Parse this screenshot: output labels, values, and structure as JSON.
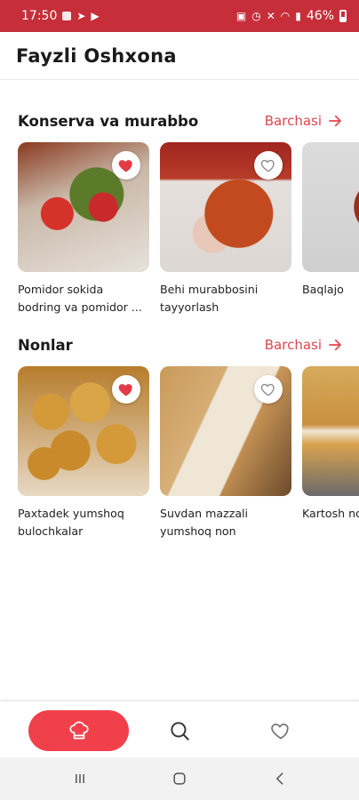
{
  "status_bar": {
    "time": "17:50",
    "battery": "46%"
  },
  "app_bar": {
    "title": "Fayzli Oshxona"
  },
  "sections": [
    {
      "title": "Konserva va murabbo",
      "see_all_label": "Barchasi",
      "items": [
        {
          "title": "Pomidor sokida bodring va pomidor ...",
          "favorite": true
        },
        {
          "title": "Behi murabbosini tayyorlash",
          "favorite": false
        },
        {
          "title": "Baqlajo",
          "favorite": false
        }
      ]
    },
    {
      "title": "Nonlar",
      "see_all_label": "Barchasi",
      "items": [
        {
          "title": "Paxtadek yumshoq bulochkalar",
          "favorite": true
        },
        {
          "title": "Suvdan mazzali yumshoq non",
          "favorite": false
        },
        {
          "title": "Kartosh non",
          "favorite": false
        }
      ]
    }
  ],
  "bottom_nav": {
    "items": [
      {
        "icon": "chef-hat-icon",
        "active": true
      },
      {
        "icon": "search-icon",
        "active": false
      },
      {
        "icon": "heart-icon",
        "active": false
      }
    ]
  },
  "colors": {
    "status_bar": "#c62f3a",
    "accent": "#f0404a",
    "link": "#e0454f"
  }
}
